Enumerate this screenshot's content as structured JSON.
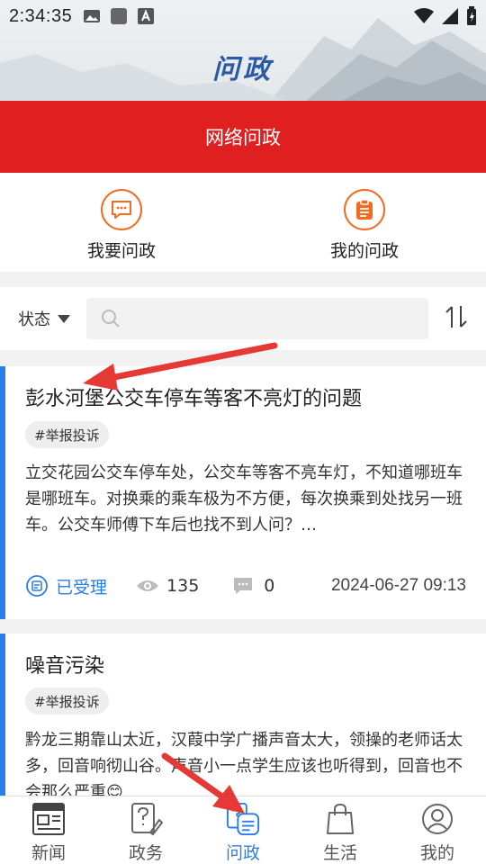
{
  "status_bar": {
    "time": "2:34:35"
  },
  "header": {
    "title": "问政"
  },
  "banner": {
    "label": "网络问政"
  },
  "actions": [
    {
      "label": "我要问政",
      "icon": "chat-icon"
    },
    {
      "label": "我的问政",
      "icon": "clipboard-icon"
    }
  ],
  "filter": {
    "status_label": "状态",
    "search_placeholder": ""
  },
  "posts": [
    {
      "title": "彭水河堡公交车停车等客不亮灯的问题",
      "tag": "#举报投诉",
      "description": "立交花园公交车停车处，公交车等客不亮车灯，不知道哪班车是哪班车。对换乘的乘车极为不方便，每次换乘到处找另一班车。公交车师傅下车后也找不到人问？…",
      "status": "已受理",
      "views": "135",
      "comments": "0",
      "date": "2024-06-27 09:13"
    },
    {
      "title": "噪音污染",
      "tag": "#举报投诉",
      "description": "黔龙三期靠山太近，汉葭中学广播声音太大，领操的老师话太多，回音响彻山谷。声音小一点学生应该也听得到，回音也不会那么严重😊"
    }
  ],
  "tabs": [
    {
      "label": "新闻",
      "icon": "news-icon"
    },
    {
      "label": "政务",
      "icon": "government-icon"
    },
    {
      "label": "问政",
      "icon": "inquiry-icon",
      "active": true
    },
    {
      "label": "生活",
      "icon": "shopping-bag-icon"
    },
    {
      "label": "我的",
      "icon": "profile-icon"
    }
  ],
  "colors": {
    "brand_red": "#e02020",
    "accent_blue": "#2b7de9",
    "action_orange": "#f26b21",
    "annotation_red": "#e53935"
  }
}
